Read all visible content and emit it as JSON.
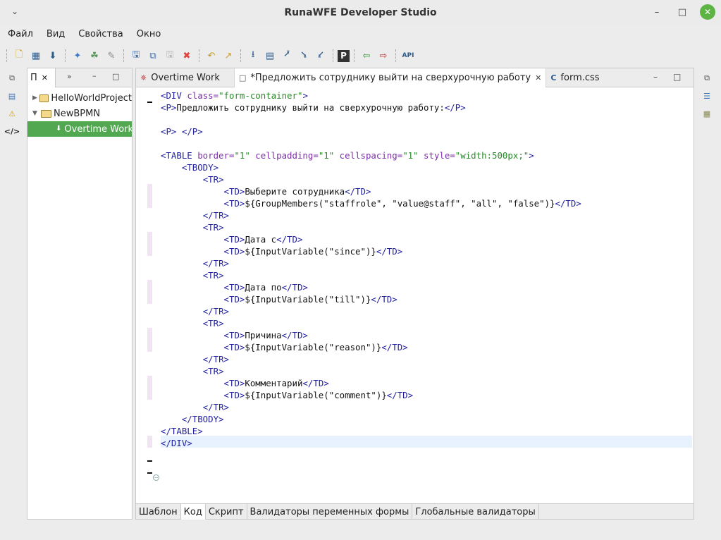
{
  "window": {
    "title": "RunaWFE Developer Studio"
  },
  "menu": [
    "Файл",
    "Вид",
    "Свойства",
    "Окно"
  ],
  "toolbar_icons": [
    "new-project-icon",
    "new-form-icon",
    "new-process-icon",
    "network-icon",
    "import-icon",
    "export-icon",
    "save-icon",
    "save-all-icon",
    "save-disabled-icon",
    "delete-icon",
    "undo-icon",
    "redo-icon",
    "align-icon",
    "grid-icon",
    "align-top-icon",
    "align-bottom-icon",
    "align-right-icon",
    "paragraph-icon",
    "import-process-icon",
    "export-process-icon",
    "api-icon"
  ],
  "project_panel": {
    "tab_label": "П",
    "items": [
      {
        "label": "HelloWorldProject",
        "type": "project",
        "expanded": false
      },
      {
        "label": "NewBPMN",
        "type": "project",
        "expanded": true
      },
      {
        "label": "Overtime Work",
        "type": "process",
        "selected": true
      }
    ]
  },
  "editor": {
    "tabs": [
      {
        "label": "Overtime Work",
        "icon": "process-icon"
      },
      {
        "label": "*Предложить сотруднику выйти на сверхурочную работу",
        "icon": "form-icon",
        "active": true
      },
      {
        "label": "form.css",
        "icon": "css-icon"
      }
    ],
    "bottom_tabs": [
      "Шаблон",
      "Код",
      "Скрипт",
      "Валидаторы переменных формы",
      "Глобальные валидаторы"
    ],
    "active_bottom_tab": "Код",
    "code_lines": [
      [
        [
          "tag",
          "<DIV "
        ],
        [
          "attr",
          "class="
        ],
        [
          "val",
          "\"form-container\""
        ],
        [
          "tag",
          ">"
        ]
      ],
      [
        [
          "tag",
          "<P>"
        ],
        [
          "txt",
          "Предложить сотруднику выйти на сверхурочную работу:"
        ],
        [
          "tag",
          "</P>"
        ]
      ],
      [],
      [
        [
          "tag",
          "<P>"
        ],
        [
          "txt",
          " "
        ],
        [
          "tag",
          "</P>"
        ]
      ],
      [],
      [
        [
          "tag",
          "<TABLE "
        ],
        [
          "attr",
          "border="
        ],
        [
          "val",
          "\"1\""
        ],
        [
          "attr",
          " cellpadding="
        ],
        [
          "val",
          "\"1\""
        ],
        [
          "attr",
          " cellspacing="
        ],
        [
          "val",
          "\"1\""
        ],
        [
          "attr",
          " style="
        ],
        [
          "val",
          "\"width:500px;\""
        ],
        [
          "tag",
          ">"
        ]
      ],
      [
        [
          "txt",
          "    "
        ],
        [
          "tag",
          "<TBODY>"
        ]
      ],
      [
        [
          "txt",
          "        "
        ],
        [
          "tag",
          "<TR>"
        ]
      ],
      [
        [
          "txt",
          "            "
        ],
        [
          "tag",
          "<TD>"
        ],
        [
          "txt",
          "Выберите сотрудника"
        ],
        [
          "tag",
          "</TD>"
        ]
      ],
      [
        [
          "txt",
          "            "
        ],
        [
          "tag",
          "<TD>"
        ],
        [
          "txt",
          "${GroupMembers(\"staffrole\", \"value@staff\", \"all\", \"false\")}"
        ],
        [
          "tag",
          "</TD>"
        ]
      ],
      [
        [
          "txt",
          "        "
        ],
        [
          "tag",
          "</TR>"
        ]
      ],
      [
        [
          "txt",
          "        "
        ],
        [
          "tag",
          "<TR>"
        ]
      ],
      [
        [
          "txt",
          "            "
        ],
        [
          "tag",
          "<TD>"
        ],
        [
          "txt",
          "Дата с"
        ],
        [
          "tag",
          "</TD>"
        ]
      ],
      [
        [
          "txt",
          "            "
        ],
        [
          "tag",
          "<TD>"
        ],
        [
          "txt",
          "${InputVariable(\"since\")}"
        ],
        [
          "tag",
          "</TD>"
        ]
      ],
      [
        [
          "txt",
          "        "
        ],
        [
          "tag",
          "</TR>"
        ]
      ],
      [
        [
          "txt",
          "        "
        ],
        [
          "tag",
          "<TR>"
        ]
      ],
      [
        [
          "txt",
          "            "
        ],
        [
          "tag",
          "<TD>"
        ],
        [
          "txt",
          "Дата по"
        ],
        [
          "tag",
          "</TD>"
        ]
      ],
      [
        [
          "txt",
          "            "
        ],
        [
          "tag",
          "<TD>"
        ],
        [
          "txt",
          "${InputVariable(\"till\")}"
        ],
        [
          "tag",
          "</TD>"
        ]
      ],
      [
        [
          "txt",
          "        "
        ],
        [
          "tag",
          "</TR>"
        ]
      ],
      [
        [
          "txt",
          "        "
        ],
        [
          "tag",
          "<TR>"
        ]
      ],
      [
        [
          "txt",
          "            "
        ],
        [
          "tag",
          "<TD>"
        ],
        [
          "txt",
          "Причина"
        ],
        [
          "tag",
          "</TD>"
        ]
      ],
      [
        [
          "txt",
          "            "
        ],
        [
          "tag",
          "<TD>"
        ],
        [
          "txt",
          "${InputVariable(\"reason\")}"
        ],
        [
          "tag",
          "</TD>"
        ]
      ],
      [
        [
          "txt",
          "        "
        ],
        [
          "tag",
          "</TR>"
        ]
      ],
      [
        [
          "txt",
          "        "
        ],
        [
          "tag",
          "<TR>"
        ]
      ],
      [
        [
          "txt",
          "            "
        ],
        [
          "tag",
          "<TD>"
        ],
        [
          "txt",
          "Комментарий"
        ],
        [
          "tag",
          "</TD>"
        ]
      ],
      [
        [
          "txt",
          "            "
        ],
        [
          "tag",
          "<TD>"
        ],
        [
          "txt",
          "${InputVariable(\"comment\")}"
        ],
        [
          "tag",
          "</TD>"
        ]
      ],
      [
        [
          "txt",
          "        "
        ],
        [
          "tag",
          "</TR>"
        ]
      ],
      [
        [
          "txt",
          "    "
        ],
        [
          "tag",
          "</TBODY>"
        ]
      ],
      [
        [
          "tag",
          "</TABLE>"
        ]
      ],
      [
        [
          "tag",
          "</DIV>"
        ]
      ]
    ]
  }
}
